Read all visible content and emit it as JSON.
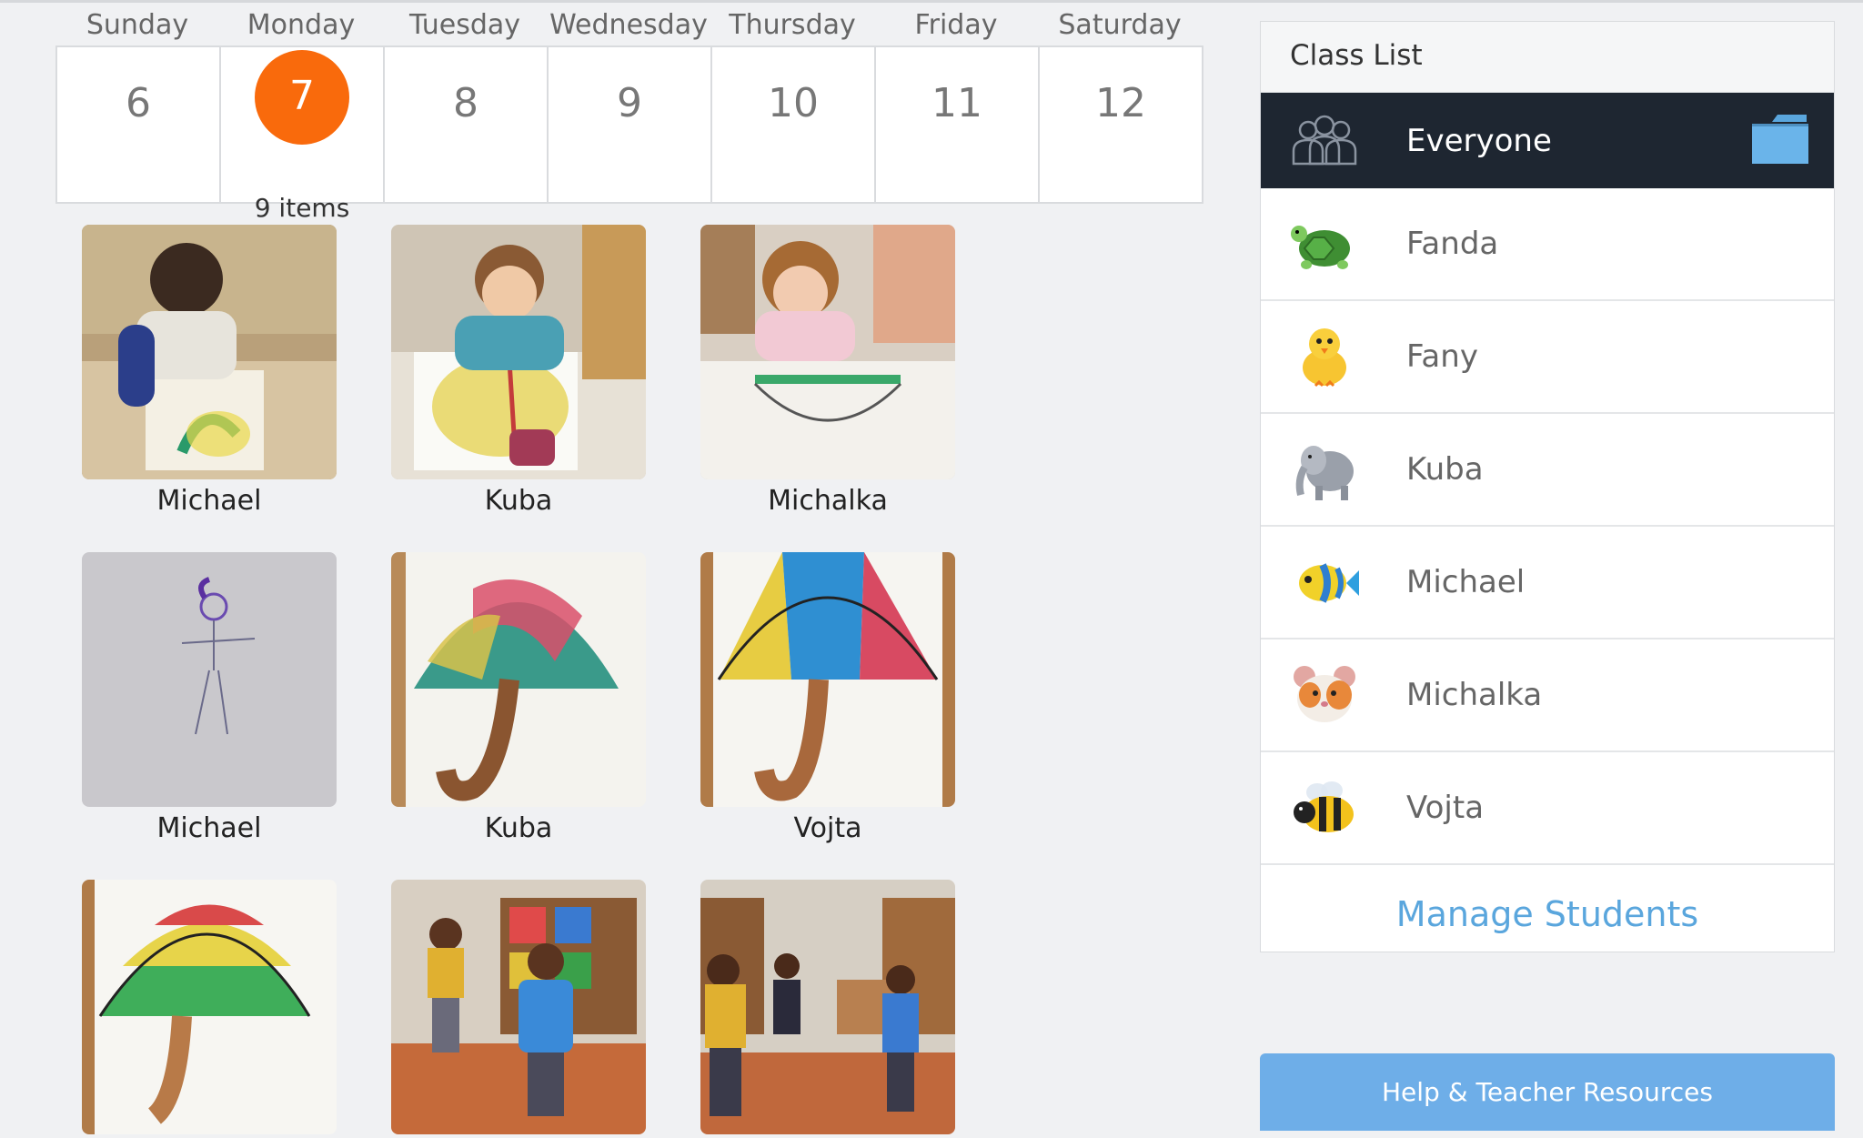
{
  "week": {
    "day_names": [
      "Sunday",
      "Monday",
      "Tuesday",
      "Wednesday",
      "Thursday",
      "Friday",
      "Saturday"
    ],
    "days": [
      {
        "num": "6",
        "count": ""
      },
      {
        "num": "7",
        "count": "9 items",
        "selected": true
      },
      {
        "num": "8",
        "count": ""
      },
      {
        "num": "9",
        "count": ""
      },
      {
        "num": "10",
        "count": ""
      },
      {
        "num": "11",
        "count": ""
      },
      {
        "num": "12",
        "count": ""
      }
    ],
    "accent_color": "#f96a0c"
  },
  "posts": [
    {
      "caption": "Michael",
      "subject": "boy-painting"
    },
    {
      "caption": "Kuba",
      "subject": "boy-painting-sun"
    },
    {
      "caption": "Michalka",
      "subject": "girl-painting-umbrella"
    },
    {
      "caption": "Michael",
      "subject": "pencil-figure-drawing"
    },
    {
      "caption": "Kuba",
      "subject": "colorful-umbrella-painting"
    },
    {
      "caption": "Vojta",
      "subject": "striped-umbrella-painting"
    },
    {
      "caption": "",
      "subject": "rainbow-umbrella-painting"
    },
    {
      "caption": "",
      "subject": "kids-in-classroom"
    },
    {
      "caption": "",
      "subject": "kids-in-classroom-2"
    }
  ],
  "class_list": {
    "title": "Class List",
    "everyone_label": "Everyone",
    "students": [
      {
        "name": "Fanda",
        "icon": "turtle-icon"
      },
      {
        "name": "Fany",
        "icon": "chick-icon"
      },
      {
        "name": "Kuba",
        "icon": "elephant-icon"
      },
      {
        "name": "Michael",
        "icon": "tropical-fish-icon"
      },
      {
        "name": "Michalka",
        "icon": "hamster-icon"
      },
      {
        "name": "Vojta",
        "icon": "bee-icon"
      }
    ],
    "manage_label": "Manage Students"
  },
  "help_label": "Help & Teacher Resources"
}
